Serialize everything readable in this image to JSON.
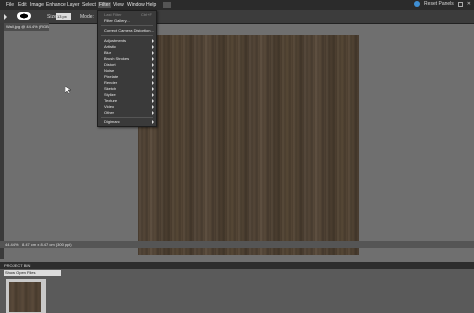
{
  "menubar": {
    "items": [
      "File",
      "Edit",
      "Image",
      "Enhance",
      "Layer",
      "Select",
      "Filter",
      "View",
      "Window",
      "Help"
    ],
    "active": "Filter",
    "reset_panels": "Reset Panels"
  },
  "options": {
    "size_label": "Size:",
    "size_value": "13 px",
    "mode_label": "Mode:"
  },
  "document": {
    "tab_title": "Wall.jpg @ 44.4% (RGB/8)",
    "zoom": "44.44%",
    "info": "8.47 cm x 8.47 cm (300 ppi)"
  },
  "filter_menu": {
    "items": [
      {
        "label": "Last Filter",
        "shortcut": "Ctrl+F",
        "disabled": true
      },
      {
        "label": "Filter Gallery...",
        "disabled": false
      },
      {
        "label": "Correct Camera Distortion...",
        "disabled": false
      },
      {
        "label": "Adjustments",
        "submenu": true
      },
      {
        "label": "Artistic",
        "submenu": true
      },
      {
        "label": "Blur",
        "submenu": true
      },
      {
        "label": "Brush Strokes",
        "submenu": true
      },
      {
        "label": "Distort",
        "submenu": true
      },
      {
        "label": "Noise",
        "submenu": true
      },
      {
        "label": "Pixelate",
        "submenu": true
      },
      {
        "label": "Render",
        "submenu": true
      },
      {
        "label": "Sketch",
        "submenu": true
      },
      {
        "label": "Stylize",
        "submenu": true
      },
      {
        "label": "Texture",
        "submenu": true
      },
      {
        "label": "Video",
        "submenu": true
      },
      {
        "label": "Other",
        "submenu": true
      },
      {
        "label": "Digimarc",
        "submenu": true
      }
    ]
  },
  "project_bin": {
    "title": "PROJECT BIN",
    "select": "Show Open Files"
  },
  "colors": {
    "menubar_bg": "#2b2b2b",
    "workspace_bg": "#6f6f6f",
    "accent": "#3f8fd4"
  }
}
